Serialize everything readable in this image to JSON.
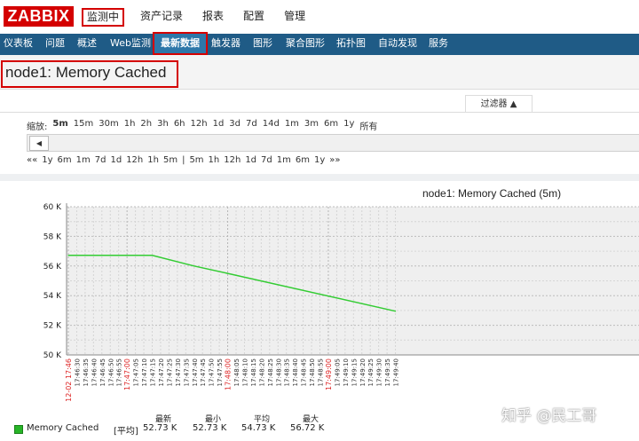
{
  "header": {
    "logo": "ZABBIX",
    "menu": [
      "监测中",
      "资产记录",
      "报表",
      "配置",
      "管理"
    ]
  },
  "subnav": [
    "仪表板",
    "问题",
    "概述",
    "Web监测",
    "最新数据",
    "触发器",
    "图形",
    "聚合图形",
    "拓扑图",
    "自动发现",
    "服务"
  ],
  "page": {
    "title": "node1: Memory Cached"
  },
  "filter": {
    "label": "过滤器 ▲"
  },
  "zoom": {
    "label": "缩放:",
    "options": [
      "5m",
      "15m",
      "30m",
      "1h",
      "2h",
      "3h",
      "6h",
      "12h",
      "1d",
      "3d",
      "7d",
      "14d",
      "1m",
      "3m",
      "6m",
      "1y",
      "所有"
    ],
    "selected": "5m"
  },
  "scroll": {
    "left_arrow": "◀"
  },
  "nav": {
    "back": [
      "««",
      "1y",
      "6m",
      "1m",
      "7d",
      "1d",
      "12h",
      "1h",
      "5m"
    ],
    "divider": "|",
    "forward": [
      "5m",
      "1h",
      "12h",
      "1d",
      "7d",
      "1m",
      "6m",
      "1y",
      "»»"
    ]
  },
  "chart_data": {
    "type": "line",
    "title": "node1: Memory Cached (5m)",
    "ylim": [
      50,
      60
    ],
    "y_unit": "K",
    "y_ticks": [
      "60 K",
      "58 K",
      "56 K",
      "54 K",
      "52 K",
      "50 K"
    ],
    "x_ticks": [
      {
        "label": "12-02 17:46",
        "major": true
      },
      {
        "label": "17:46:30"
      },
      {
        "label": "17:46:35"
      },
      {
        "label": "17:46:40"
      },
      {
        "label": "17:46:45"
      },
      {
        "label": "17:46:50"
      },
      {
        "label": "17:46:55"
      },
      {
        "label": "17:47:00",
        "major": true
      },
      {
        "label": "17:47:05"
      },
      {
        "label": "17:47:10"
      },
      {
        "label": "17:47:15"
      },
      {
        "label": "17:47:20"
      },
      {
        "label": "17:47:25"
      },
      {
        "label": "17:47:30"
      },
      {
        "label": "17:47:35"
      },
      {
        "label": "17:47:40"
      },
      {
        "label": "17:47:45"
      },
      {
        "label": "17:47:50"
      },
      {
        "label": "17:47:55"
      },
      {
        "label": "17:48:00",
        "major": true
      },
      {
        "label": "17:48:05"
      },
      {
        "label": "17:48:10"
      },
      {
        "label": "17:48:15"
      },
      {
        "label": "17:48:20"
      },
      {
        "label": "17:48:25"
      },
      {
        "label": "17:48:30"
      },
      {
        "label": "17:48:35"
      },
      {
        "label": "17:48:40"
      },
      {
        "label": "17:48:45"
      },
      {
        "label": "17:48:50"
      },
      {
        "label": "17:48:55"
      },
      {
        "label": "17:49:00",
        "major": true
      },
      {
        "label": "17:49:05"
      },
      {
        "label": "17:49:10"
      },
      {
        "label": "17:49:15"
      },
      {
        "label": "17:49:20"
      },
      {
        "label": "17:49:25"
      },
      {
        "label": "17:49:30"
      },
      {
        "label": "17:49:35"
      },
      {
        "label": "17:49:40"
      }
    ],
    "series": [
      {
        "name": "Memory Cached",
        "color": "#33cc33",
        "points": [
          {
            "x": "17:46:25",
            "y": 56.72
          },
          {
            "x": "17:47:15",
            "y": 56.72
          },
          {
            "x": "17:47:40",
            "y": 56.0
          },
          {
            "x": "17:48:00",
            "y": 55.5
          },
          {
            "x": "17:49:40",
            "y": 52.95
          }
        ]
      }
    ]
  },
  "legend": {
    "name": "Memory Cached",
    "func": "[平均]",
    "headers": [
      "最新",
      "最小",
      "平均",
      "最大"
    ],
    "values": [
      "52.73 K",
      "52.73 K",
      "54.73 K",
      "56.72 K"
    ]
  },
  "watermark": "知乎 @民工哥"
}
